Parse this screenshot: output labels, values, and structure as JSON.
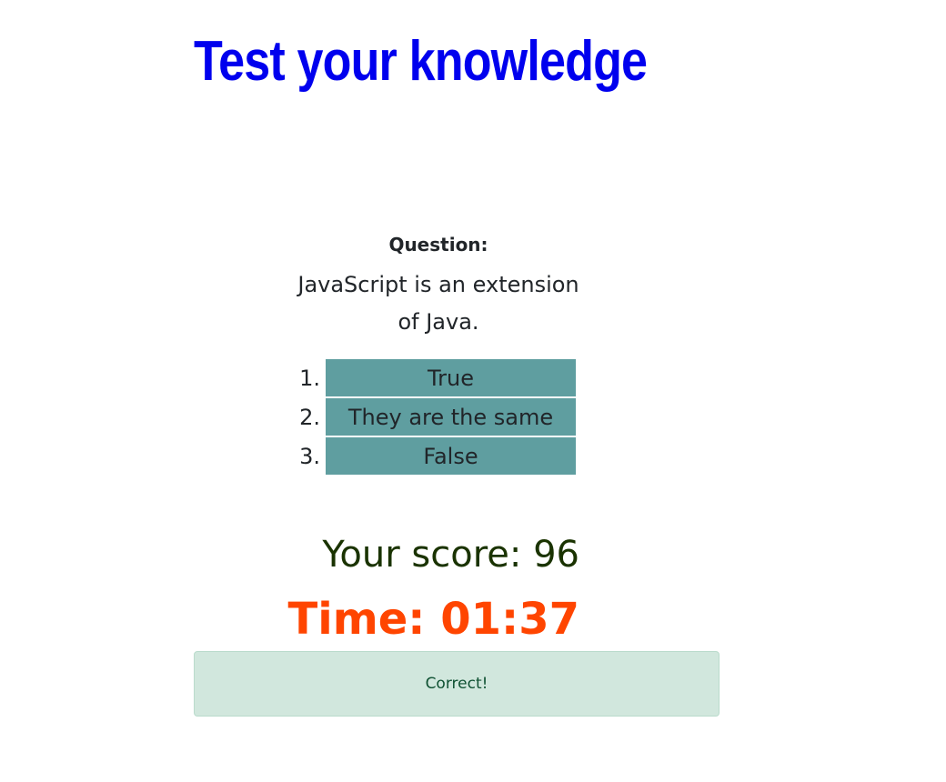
{
  "header": {
    "title": "Test your knowledge"
  },
  "quiz": {
    "question_label": "Question:",
    "question_text": "JavaScript is an extension of Java.",
    "choices": [
      {
        "number": "1.",
        "label": "True"
      },
      {
        "number": "2.",
        "label": "They are the same"
      },
      {
        "number": "3.",
        "label": "False"
      }
    ]
  },
  "status": {
    "score_text": "Your score: 96",
    "time_text": "Time: 01:37",
    "feedback": "Correct!"
  },
  "colors": {
    "title": "#0000ee",
    "choice_button": "#5f9ea0",
    "timer": "#ff4500",
    "alert_background": "#d1e7dd"
  }
}
